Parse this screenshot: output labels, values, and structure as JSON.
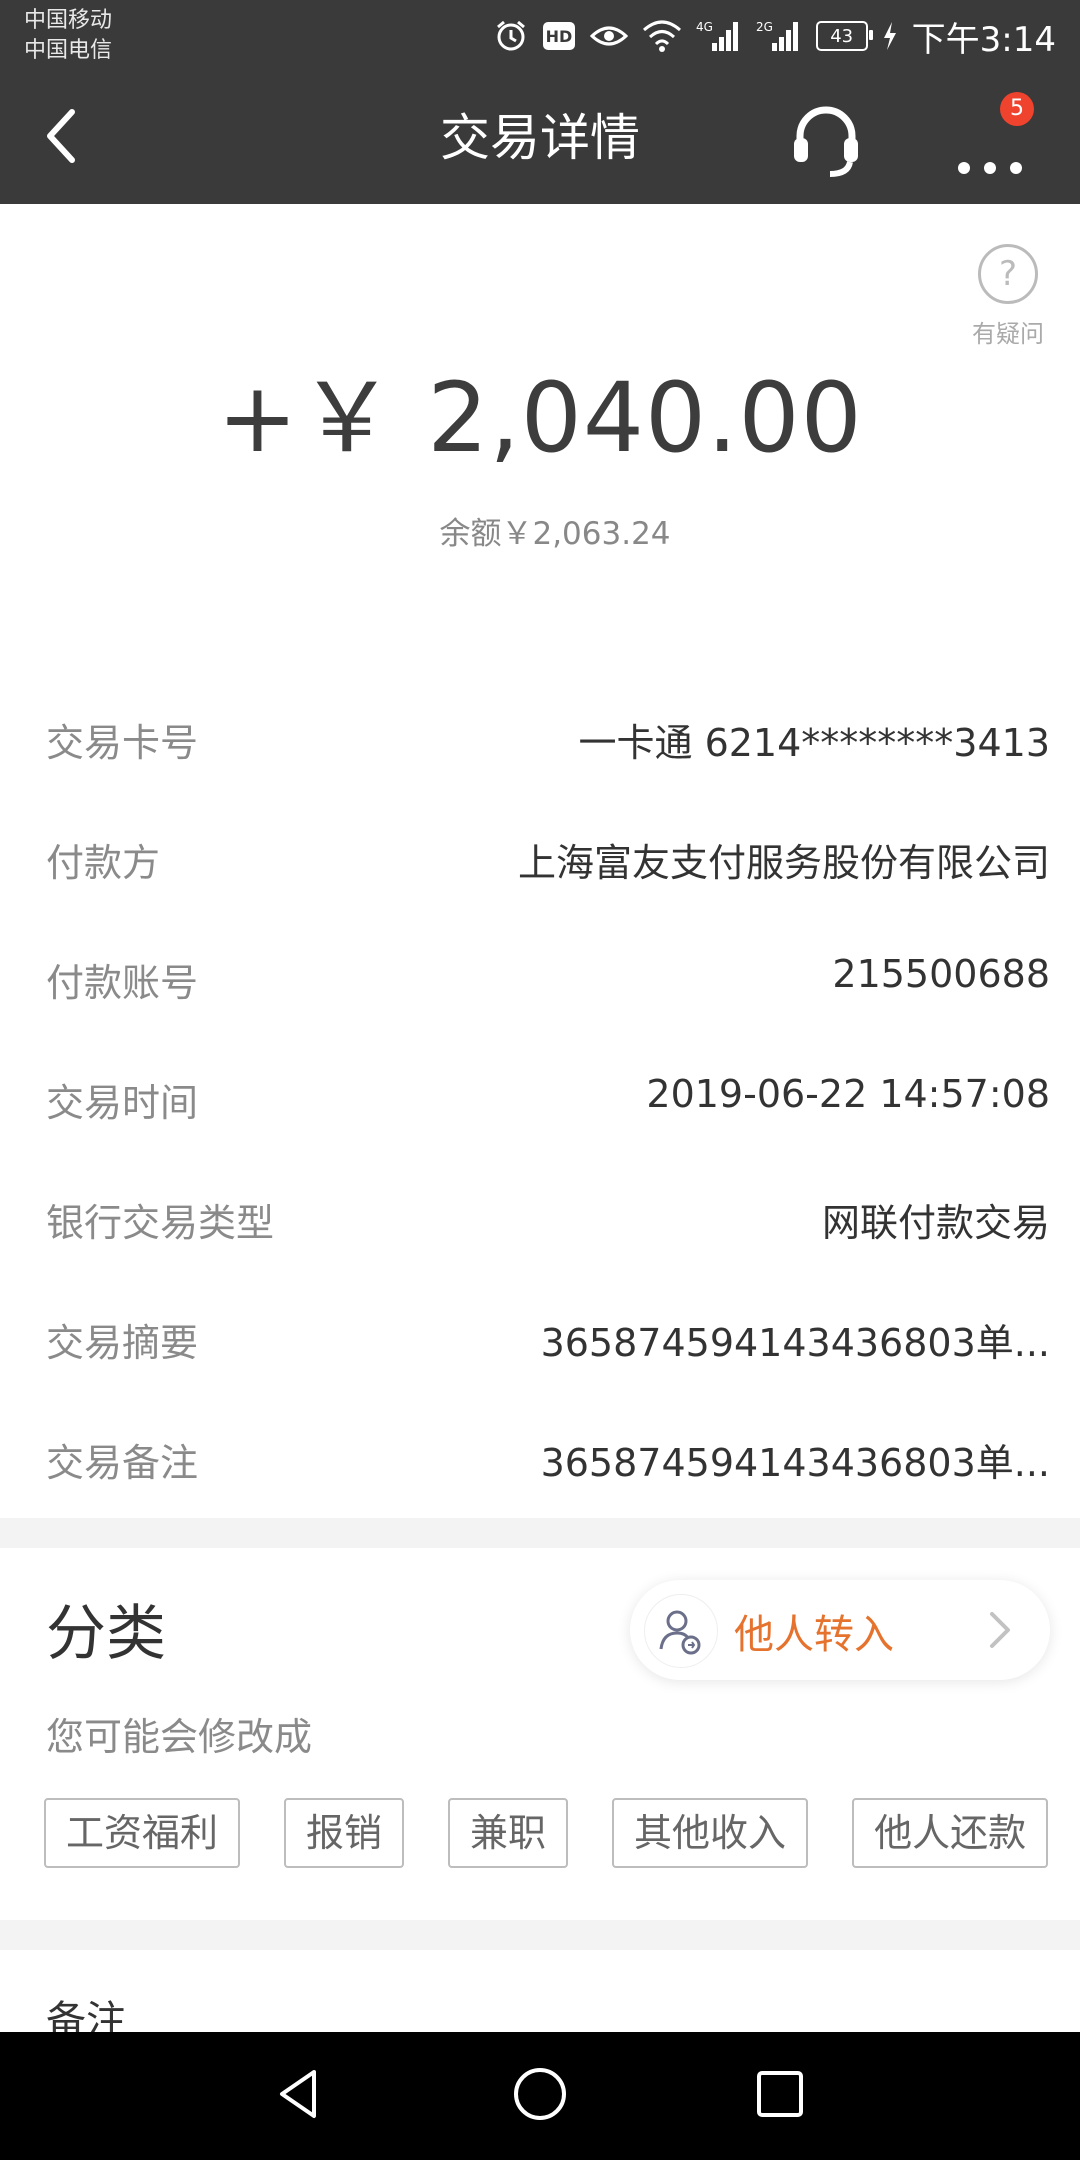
{
  "status_bar": {
    "carrier_1": "中国移动",
    "carrier_2": "中国电信",
    "network_1": "4G",
    "network_2": "2G",
    "battery": "43",
    "time": "下午3:14",
    "icons": [
      "alarm-icon",
      "hd-icon",
      "eye-icon",
      "wifi-icon",
      "signal-icon",
      "signal-icon",
      "battery-icon",
      "charging-icon"
    ]
  },
  "header": {
    "title": "交易详情",
    "badge_count": "5",
    "icons": [
      "back-arrow-icon",
      "headset-icon",
      "more-dots-icon"
    ]
  },
  "summary": {
    "amount": "+￥ 2,040.00",
    "balance": "余额￥2,063.24",
    "help_icon": "?",
    "help_label": "有疑问"
  },
  "details": [
    {
      "label": "交易卡号",
      "value": "一卡通 6214********3413"
    },
    {
      "label": "付款方",
      "value": "上海富友支付服务股份有限公司"
    },
    {
      "label": "付款账号",
      "value": "215500688"
    },
    {
      "label": "交易时间",
      "value": "2019-06-22 14:57:08"
    },
    {
      "label": "银行交易类型",
      "value": "网联付款交易"
    },
    {
      "label": "交易摘要",
      "value": "365874594143436803单..."
    },
    {
      "label": "交易备注",
      "value": "365874594143436803单..."
    }
  ],
  "category": {
    "title": "分类",
    "current": "他人转入",
    "suggest_label": "您可能会修改成",
    "tags": [
      "工资福利",
      "报销",
      "兼职",
      "其他收入",
      "他人还款"
    ]
  },
  "memo": {
    "title": "备注"
  },
  "colors": {
    "header_bg": "#3a3a3a",
    "accent": "#e5732e",
    "badge": "#f0432e"
  }
}
